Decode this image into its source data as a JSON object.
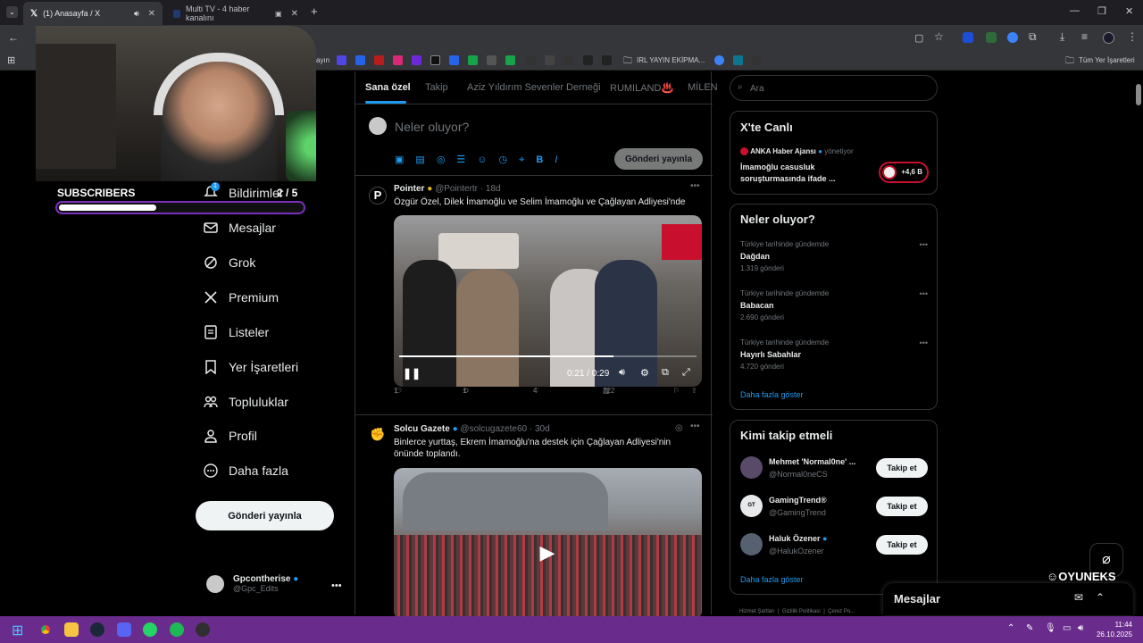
{
  "browser": {
    "tabs": [
      {
        "title": "(1) Anasayfa / X"
      },
      {
        "title": "Multi TV - 4 haber kanalını"
      }
    ],
    "bookmarks": {
      "folder": "IRL YAYIN EKİPMA...",
      "all": "Tüm Yer İşaretleri",
      "partial_label": "ayın"
    }
  },
  "stream": {
    "subscribers_label": "SUBSCRIBERS",
    "subscribers_count": "2 / 5",
    "subscribers_progress": 0.4,
    "watermark": "OYUNEKS"
  },
  "nav": {
    "items": [
      {
        "label": "Bildirimler",
        "badge": "1"
      },
      {
        "label": "Mesajlar"
      },
      {
        "label": "Grok"
      },
      {
        "label": "Premium"
      },
      {
        "label": "Listeler"
      },
      {
        "label": "Yer İşaretleri"
      },
      {
        "label": "Topluluklar"
      },
      {
        "label": "Profil"
      },
      {
        "label": "Daha fazla"
      }
    ],
    "post_button": "Gönderi yayınla",
    "profile": {
      "name": "Gpcontherise",
      "handle": "@Gpc_Edits"
    }
  },
  "timeline": {
    "tabs": [
      "Sana özel",
      "Takip",
      "Aziz Yıldırım Sevenler Derneği",
      "RUMILAND♨️",
      "MİLEN"
    ],
    "composer": {
      "placeholder": "Neler oluyor?",
      "post_button": "Gönderi yayınla"
    },
    "tweets": [
      {
        "name": "Pointer",
        "handle": "@Pointertr",
        "time": "18d",
        "text": "Özgür Özel, Dilek İmamoğlu ve Selim İmamoğlu ve Çağlayan Adliyesi'nde",
        "video_time": "0:21 / 0:29",
        "video_progress": 0.72,
        "replies": "1",
        "retweets": "1",
        "likes": "4",
        "views": "722"
      },
      {
        "name": "Solcu Gazete",
        "handle": "@solcugazete60",
        "time": "30d",
        "text": "Binlerce yurttaş, Ekrem İmamoğlu'na destek için Çağlayan Adliyesi'nin önünde toplandı."
      }
    ]
  },
  "sidebar": {
    "search_placeholder": "Ara",
    "live": {
      "title": "X'te Canlı",
      "host": "ANKA Haber Ajansı",
      "host_role": "yönetiyor",
      "topic": "İmamoğlu casusluk soruşturmasında ifade ...",
      "listeners": "+4,6 B"
    },
    "trends": {
      "title": "Neler oluyor?",
      "items": [
        {
          "context": "Türkiye tarihinde gündemde",
          "name": "Dağdan",
          "count": "1.319 gönderi"
        },
        {
          "context": "Türkiye tarihinde gündemde",
          "name": "Babacan",
          "count": "2.690 gönderi"
        },
        {
          "context": "Türkiye tarihinde gündemde",
          "name": "Hayırlı Sabahlar",
          "count": "4.720 gönderi"
        }
      ],
      "show_more": "Daha fazla göster"
    },
    "who_to_follow": {
      "title": "Kimi takip etmeli",
      "items": [
        {
          "name": "Mehmet 'Normal0ne' ...",
          "handle": "@Normal0neCS",
          "button": "Takip et"
        },
        {
          "name": "GamingTrend®",
          "handle": "@GamingTrend",
          "button": "Takip et"
        },
        {
          "name": "Haluk Özener",
          "handle": "@HalukOzener",
          "button": "Takip et"
        }
      ],
      "show_more": "Daha fazla göster"
    },
    "footer": [
      "Hizmet Şartları",
      "Gizlilik Politikası",
      "Çerez Po..."
    ],
    "messages": "Mesajlar"
  },
  "taskbar": {
    "time": "11:44",
    "date": "26.10.2025"
  }
}
